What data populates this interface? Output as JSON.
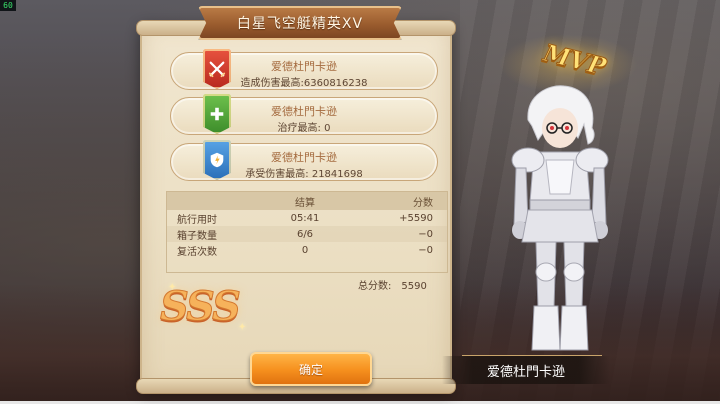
{
  "fps": "60",
  "title": "白星飞空艇精英XV",
  "awards": [
    {
      "name": "爱德杜門卡逊",
      "label": "造成伤害最高:",
      "value": "6360816238",
      "badge_color": "#d9402f",
      "icon": "crossed-swords-icon"
    },
    {
      "name": "爱德杜門卡逊",
      "label": "治疗最高:",
      "value": "0",
      "badge_color": "#55a83a",
      "icon": "heal-cross-icon"
    },
    {
      "name": "爱德杜門卡逊",
      "label": "承受伤害最高:",
      "value": "21841698",
      "badge_color": "#3f86cf",
      "icon": "shield-icon"
    }
  ],
  "score_table": {
    "headers": [
      "",
      "结算",
      "分数"
    ],
    "rows": [
      {
        "label": "航行用时",
        "result": "05:41",
        "score": "+5590"
      },
      {
        "label": "箱子数量",
        "result": "6/6",
        "score": "−0"
      },
      {
        "label": "复活次数",
        "result": "0",
        "score": "−0"
      }
    ]
  },
  "total": {
    "label": "总分数:",
    "value": "5590"
  },
  "grade": "SSS",
  "confirm_label": "确定",
  "mvp_label": "MVP",
  "player_name": "爱德杜門卡逊"
}
